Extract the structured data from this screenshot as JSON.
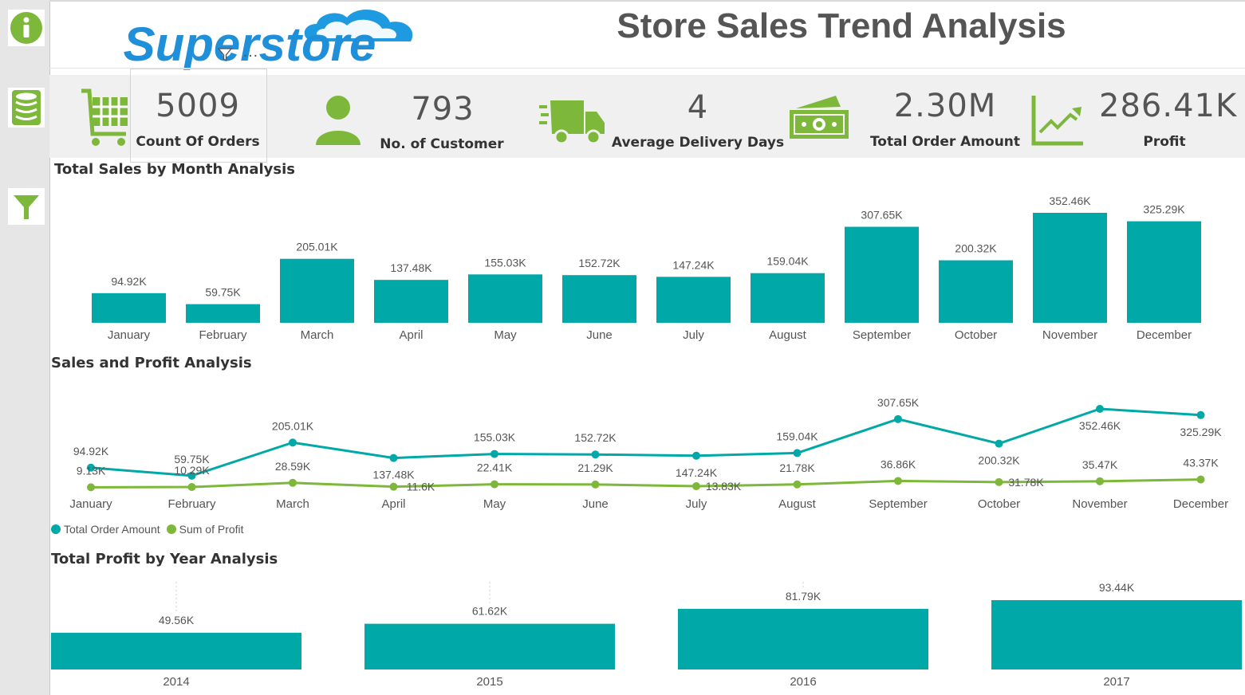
{
  "colors": {
    "teal": "#00A8A8",
    "green": "#7DB83A",
    "sidebar": "#e6e6e6",
    "kpi_band": "#f0f0f0"
  },
  "sidebar": {
    "items": [
      {
        "icon": "info-icon"
      },
      {
        "icon": "database-icon"
      },
      {
        "icon": "filter-icon"
      }
    ]
  },
  "header": {
    "logo_text": "Superstore",
    "title": "Store Sales Trend Analysis",
    "logo_overlay_icons": [
      "filter-icon",
      "more-options-icon"
    ],
    "more_options_label": "…"
  },
  "kpis": [
    {
      "icon": "shopping-cart-icon",
      "value": "5009",
      "label": "Count Of Orders"
    },
    {
      "icon": "person-icon",
      "value": "793",
      "label": "No. of Customer"
    },
    {
      "icon": "delivery-truck-icon",
      "value": "4",
      "label": "Average Delivery Days"
    },
    {
      "icon": "money-icon",
      "value": "2.30M",
      "label": "Total Order Amount"
    },
    {
      "icon": "trend-chart-icon",
      "value": "286.41K",
      "label": "Profit"
    }
  ],
  "sections": {
    "monthly_sales": "Total Sales by Month Analysis",
    "sales_profit": "Sales and Profit Analysis",
    "yearly_profit": "Total Profit by Year Analysis"
  },
  "chart_data": [
    {
      "type": "bar",
      "title": "Total Sales by Month Analysis",
      "categories": [
        "January",
        "February",
        "March",
        "April",
        "May",
        "June",
        "July",
        "August",
        "September",
        "October",
        "November",
        "December"
      ],
      "values": [
        94.92,
        59.75,
        205.01,
        137.48,
        155.03,
        152.72,
        147.24,
        159.04,
        307.65,
        200.32,
        352.46,
        325.29
      ],
      "data_labels": [
        "94.92K",
        "59.75K",
        "205.01K",
        "137.48K",
        "155.03K",
        "152.72K",
        "147.24K",
        "159.04K",
        "307.65K",
        "200.32K",
        "352.46K",
        "325.29K"
      ],
      "unit": "K",
      "ylim": [
        0,
        360
      ],
      "grid": false
    },
    {
      "type": "line",
      "title": "Sales and Profit Analysis",
      "categories": [
        "January",
        "February",
        "March",
        "April",
        "May",
        "June",
        "July",
        "August",
        "September",
        "October",
        "November",
        "December"
      ],
      "series": [
        {
          "name": "Total Order Amount",
          "color": "#00A8A8",
          "values": [
            94.92,
            59.75,
            205.01,
            137.48,
            155.03,
            152.72,
            147.24,
            159.04,
            307.65,
            200.32,
            352.46,
            325.29
          ],
          "labels": [
            "94.92K",
            "59.75K",
            "205.01K",
            "137.48K",
            "155.03K",
            "152.72K",
            "147.24K",
            "159.04K",
            "307.65K",
            "200.32K",
            "352.46K",
            "325.29K"
          ]
        },
        {
          "name": "Sum of Profit",
          "color": "#7DB83A",
          "values": [
            9.13,
            10.29,
            28.59,
            11.6,
            22.41,
            21.29,
            13.83,
            21.78,
            36.86,
            31.78,
            35.47,
            43.37
          ],
          "labels": [
            "9.13K",
            "10.29K",
            "28.59K",
            "11.6K",
            "22.41K",
            "21.29K",
            "13.83K",
            "21.78K",
            "36.86K",
            "31.78K",
            "35.47K",
            "43.37K"
          ]
        }
      ],
      "legend": "bottom-left",
      "grid": false
    },
    {
      "type": "bar",
      "title": "Total Profit by Year Analysis",
      "categories": [
        "2014",
        "2015",
        "2016",
        "2017"
      ],
      "values": [
        49.56,
        61.62,
        81.79,
        93.44
      ],
      "data_labels": [
        "49.56K",
        "61.62K",
        "81.79K",
        "93.44K"
      ],
      "unit": "K",
      "grid": false
    }
  ]
}
